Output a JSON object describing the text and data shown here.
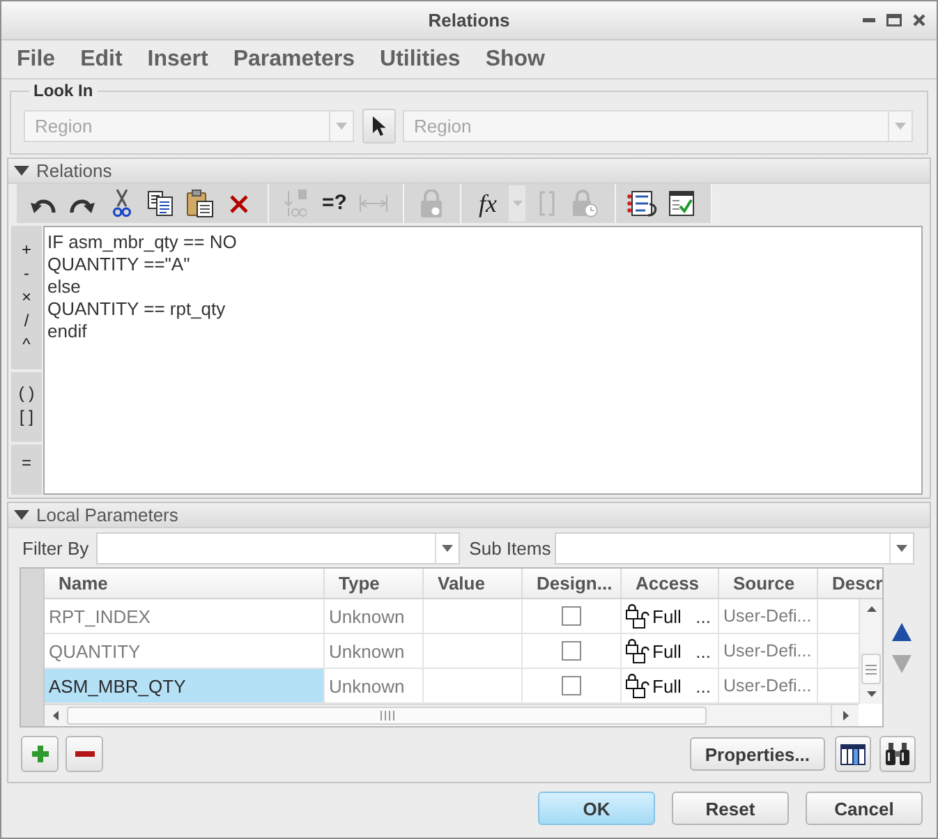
{
  "window": {
    "title": "Relations"
  },
  "menu": [
    {
      "label": "File"
    },
    {
      "label": "Edit"
    },
    {
      "label": "Insert"
    },
    {
      "label": "Parameters"
    },
    {
      "label": "Utilities"
    },
    {
      "label": "Show"
    }
  ],
  "look_in": {
    "label": "Look In",
    "selectors": [
      {
        "value": "Region",
        "disabled": true
      },
      {
        "value": "Region",
        "disabled": true
      }
    ]
  },
  "relations": {
    "title": "Relations",
    "expanded": true,
    "toolbar": [
      [
        {
          "kind": "undo",
          "disabled": false
        },
        {
          "kind": "redo",
          "disabled": false
        },
        {
          "kind": "cut",
          "disabled": false
        },
        {
          "kind": "copy",
          "disabled": false
        },
        {
          "kind": "paste",
          "disabled": false
        },
        {
          "kind": "delete",
          "disabled": false
        }
      ],
      [
        {
          "kind": "sort",
          "disabled": true
        },
        {
          "kind": "text",
          "label": "=?",
          "disabled": false
        },
        {
          "kind": "dimension",
          "disabled": true
        }
      ],
      [
        {
          "kind": "padlock",
          "disabled": true
        }
      ],
      [
        {
          "kind": "function",
          "label": "fx",
          "disabled": false
        },
        {
          "kind": "dropdown",
          "disabled": true
        },
        {
          "kind": "brackets",
          "disabled": true
        },
        {
          "kind": "clock",
          "disabled": true
        }
      ],
      [
        {
          "kind": "list",
          "disabled": false
        },
        {
          "kind": "verify",
          "disabled": false
        }
      ]
    ],
    "operators": [
      [
        "+",
        "-",
        "×",
        "/",
        "^"
      ],
      [
        "( )",
        "[ ]"
      ],
      [
        "="
      ]
    ],
    "lines": [
      "IF asm_mbr_qty == NO",
      "QUANTITY ==\"A\"",
      "else",
      "QUANTITY == rpt_qty",
      "endif"
    ]
  },
  "local_parameters": {
    "title": "Local Parameters",
    "expanded": true,
    "filter_by": {
      "label": "Filter By"
    },
    "sub_items": {
      "label": "Sub Items"
    },
    "table": {
      "columns": [
        "Name",
        "Type",
        "Value",
        "Design...",
        "Access",
        "Source",
        "Descr"
      ],
      "rows": [
        {
          "name": "RPT_INDEX",
          "type": "Unknown",
          "designate": false,
          "access": "Full",
          "access_action": "...",
          "source": "User-Defi...",
          "selected": false
        },
        {
          "name": "QUANTITY",
          "type": "Unknown",
          "designate": false,
          "access": "Full",
          "access_action": "...",
          "source": "User-Defi...",
          "selected": false
        },
        {
          "name": "ASM_MBR_QTY",
          "type": "Unknown",
          "designate": false,
          "access": "Full",
          "access_action": "...",
          "source": "User-Defi...",
          "selected": true
        }
      ]
    },
    "row_order": [
      {
        "kind": "up",
        "disabled": false
      },
      {
        "kind": "down",
        "disabled": true
      }
    ],
    "properties_button": {
      "label": "Properties..."
    }
  },
  "buttons": [
    {
      "label": "OK",
      "default": true
    },
    {
      "label": "Reset",
      "default": false
    },
    {
      "label": "Cancel",
      "default": false
    }
  ]
}
